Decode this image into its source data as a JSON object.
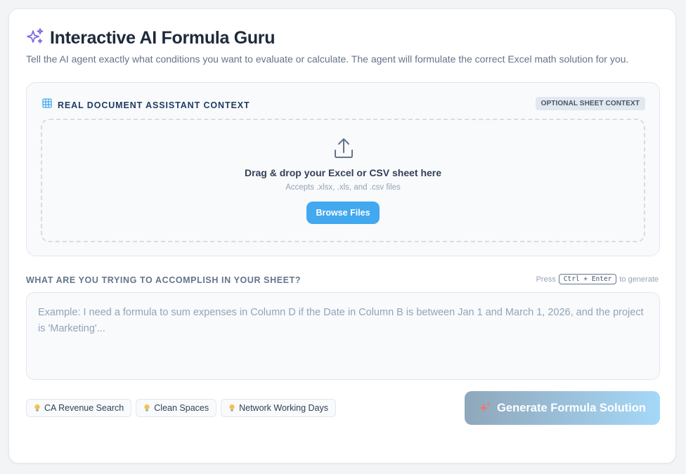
{
  "header": {
    "title": "Interactive AI Formula Guru",
    "subtitle": "Tell the AI agent exactly what conditions you want to evaluate or calculate. The agent will formulate the correct Excel math solution for you."
  },
  "context": {
    "title": "REAL DOCUMENT ASSISTANT CONTEXT",
    "badge": "OPTIONAL SHEET CONTEXT",
    "dropzone": {
      "title": "Drag & drop your Excel or CSV sheet here",
      "hint": "Accepts .xlsx, .xls, and .csv files",
      "browse_label": "Browse Files"
    }
  },
  "prompt": {
    "label": "WHAT ARE YOU TRYING TO ACCOMPLISH IN YOUR SHEET?",
    "shortcut_prefix": "Press",
    "shortcut_key": "Ctrl + Enter",
    "shortcut_suffix": "to generate",
    "placeholder": "Example: I need a formula to sum expenses in Column D if the Date in Column B is between Jan 1 and March 1, 2026, and the project is 'Marketing'..."
  },
  "suggestions": [
    {
      "label": "CA Revenue Search"
    },
    {
      "label": "Clean Spaces"
    },
    {
      "label": "Network Working Days"
    }
  ],
  "generate_label": "Generate Formula Solution",
  "icons": {
    "title": "sparkles-icon",
    "context": "grid-icon",
    "upload": "upload-icon",
    "chip": "lightbulb-icon",
    "generate": "sparkle-icon"
  },
  "colors": {
    "sparkle": "#7c6fe0",
    "browse_button": "#42a8ef",
    "generate_start": "#8fa7ba",
    "generate_end": "#a5d8f8",
    "generate_icon": "#f97366",
    "bulb": "#f2c14e"
  }
}
